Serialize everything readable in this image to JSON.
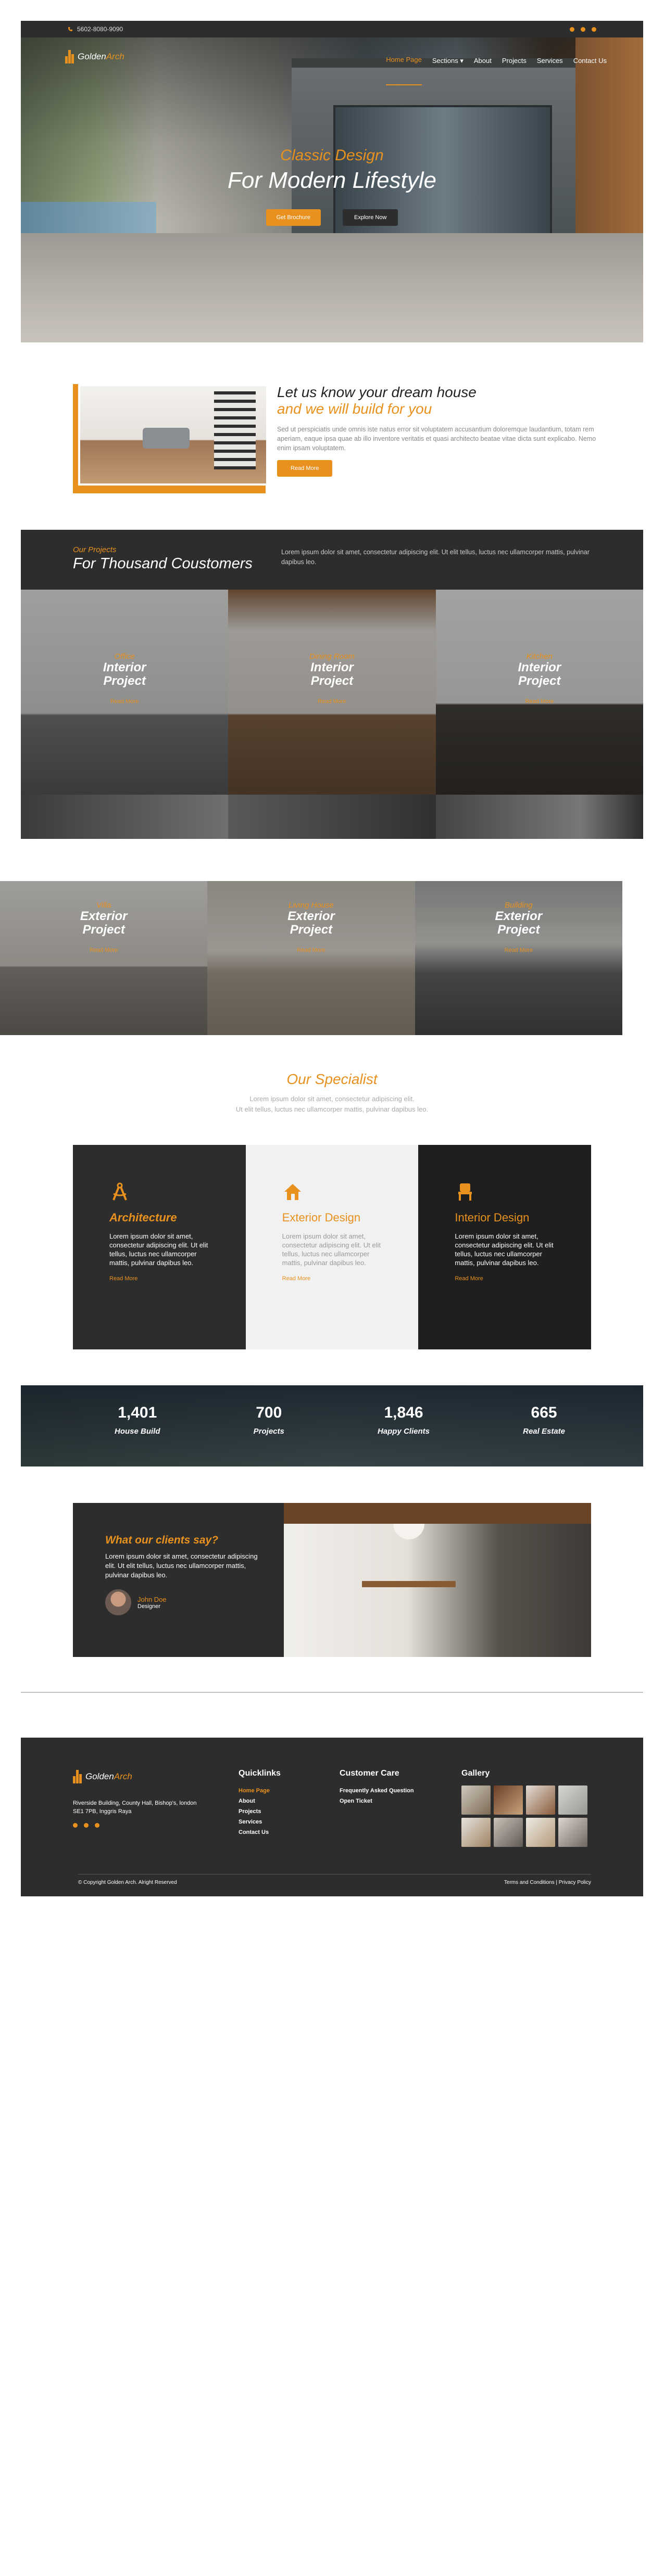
{
  "topbar": {
    "phone": "5602-8080-9090",
    "social_icons": [
      "facebook-icon",
      "twitter-icon",
      "youtube-icon"
    ]
  },
  "brand": {
    "logo_part1": "Golden",
    "logo_part2": "Arch",
    "accent_color": "#e8911e",
    "dark_color": "#2d2d2d"
  },
  "nav": {
    "items": [
      {
        "label": "Home Page",
        "active": true
      },
      {
        "label": "Sections",
        "dropdown": true
      },
      {
        "label": "About"
      },
      {
        "label": "Projects"
      },
      {
        "label": "Services"
      },
      {
        "label": "Contact Us"
      }
    ]
  },
  "hero": {
    "subtitle": "Classic Design",
    "title": "For Modern Lifestyle",
    "primary_button": "Get Brochure",
    "secondary_button": "Explore Now"
  },
  "about": {
    "heading_line1": "Let us know your dream house",
    "heading_line2": "and we will build for you",
    "paragraph": "Sed ut perspiciatis unde omnis iste natus error sit voluptatem accusantium doloremque laudantium, totam rem aperiam, eaque ipsa quae ab illo inventore veritatis et quasi architecto beatae vitae dicta sunt explicabo. Nemo enim ipsam voluptatem.",
    "button": "Read More"
  },
  "projects": {
    "eyebrow": "Our Projects",
    "title": "For Thousand Coustomers",
    "description": "Lorem ipsum dolor sit amet, consectetur adipiscing elit. Ut elit tellus, luctus nec ullamcorper mattis, pulvinar dapibus leo.",
    "interior": [
      {
        "category": "Office",
        "title_line1": "Interior",
        "title_line2": "Project",
        "link": "Read More"
      },
      {
        "category": "Dining Room",
        "title_line1": "Interior",
        "title_line2": "Project",
        "link": "Read More"
      },
      {
        "category": "Kitchen",
        "title_line1": "Interior",
        "title_line2": "Project",
        "link": "Read More"
      }
    ],
    "exterior": [
      {
        "category": "Villa",
        "title_line1": "Exterior",
        "title_line2": "Project",
        "link": "Read More"
      },
      {
        "category": "Living House",
        "title_line1": "Exterior",
        "title_line2": "Project",
        "link": "Read More"
      },
      {
        "category": "Building",
        "title_line1": "Exterior",
        "title_line2": "Project",
        "link": "Read More"
      }
    ]
  },
  "specialist": {
    "title": "Our Specialist",
    "subtitle_line1": "Lorem ipsum dolor sit amet, consectetur adipiscing elit.",
    "subtitle_line2": "Ut elit tellus, luctus nec ullamcorper mattis, pulvinar dapibus leo.",
    "services": [
      {
        "icon": "compass-icon",
        "title": "Architecture",
        "text": "Lorem ipsum dolor sit amet, consectetur adipiscing elit. Ut elit tellus, luctus nec ullamcorper mattis, pulvinar dapibus leo.",
        "link": "Read More"
      },
      {
        "icon": "house-icon",
        "title": "Exterior Design",
        "text": "Lorem ipsum dolor sit amet, consectetur adipiscing elit. Ut elit tellus, luctus nec ullamcorper mattis, pulvinar dapibus leo.",
        "link": "Read More"
      },
      {
        "icon": "chair-icon",
        "title": "Interior Design",
        "text": "Lorem ipsum dolor sit amet, consectetur adipiscing elit. Ut elit tellus, luctus nec ullamcorper mattis, pulvinar dapibus leo.",
        "link": "Read More"
      }
    ]
  },
  "counters": [
    {
      "number": "1,401",
      "label": "House Build"
    },
    {
      "number": "700",
      "label": "Projects"
    },
    {
      "number": "1,846",
      "label": "Happy Clients"
    },
    {
      "number": "665",
      "label": "Real Estate"
    }
  ],
  "testimonial": {
    "heading": "What our clients say?",
    "quote": "Lorem ipsum dolor sit amet, consectetur adipiscing elit. Ut elit tellus, luctus nec ullamcorper mattis, pulvinar dapibus leo.",
    "name": "John Doe",
    "role": "Designer"
  },
  "footer": {
    "address": "Riverside Building, County Hall, Bishop's, london SE1 7PB, Inggris Raya",
    "quicklinks_title": "Quicklinks",
    "quicklinks": [
      "Home Page",
      "About",
      "Projects",
      "Services",
      "Contact Us"
    ],
    "care_title": "Customer Care",
    "care_links": [
      "Frequently Asked Question",
      "Open Ticket"
    ],
    "gallery_title": "Gallery",
    "copyright": "© Copyright Golden Arch. Alright Reserved",
    "legal": "Terms and Conditions | Privacy Policy"
  }
}
